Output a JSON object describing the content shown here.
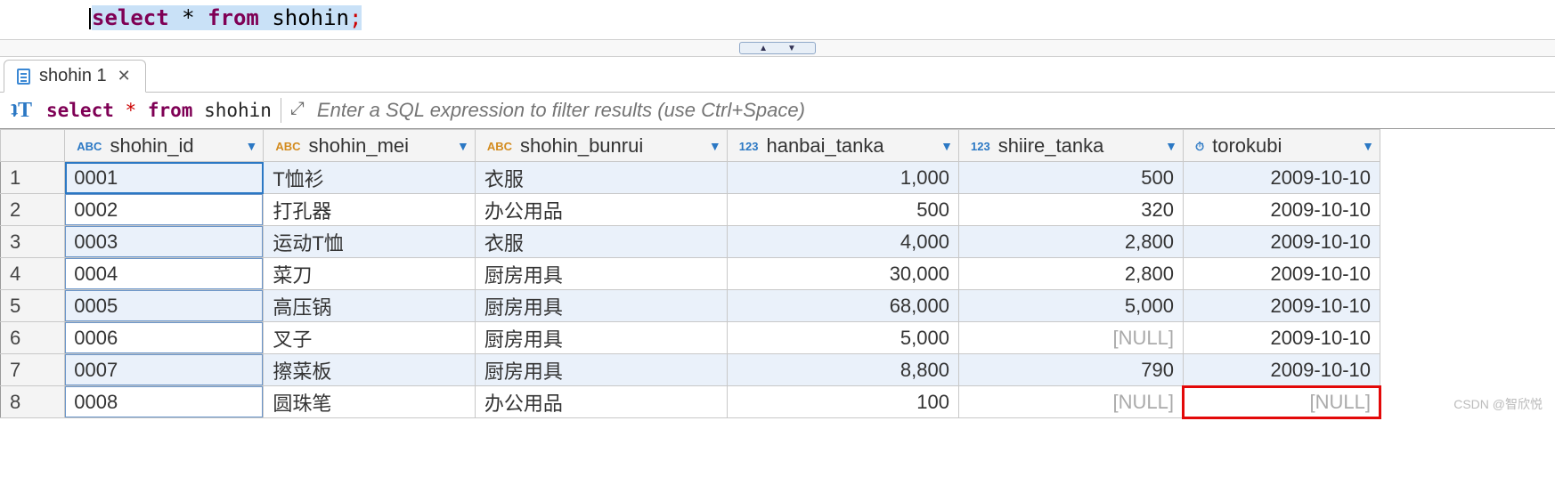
{
  "editor": {
    "sql_select": "select",
    "sql_star": "*",
    "sql_from": "from",
    "sql_table": "shohin",
    "sql_semi": ";"
  },
  "tab": {
    "label": "shohin 1"
  },
  "filter": {
    "kw_select": "select",
    "star": "*",
    "kw_from": "from",
    "tbl": "shohin",
    "placeholder": "Enter a SQL expression to filter results (use Ctrl+Space)"
  },
  "columns": [
    {
      "key": "shohin_id",
      "label": "shohin_id",
      "type": "ABC",
      "icon": "t-abc-key"
    },
    {
      "key": "shohin_mei",
      "label": "shohin_mei",
      "type": "ABC",
      "icon": "t-abc"
    },
    {
      "key": "shohin_bunrui",
      "label": "shohin_bunrui",
      "type": "ABC",
      "icon": "t-abc"
    },
    {
      "key": "hanbai_tanka",
      "label": "hanbai_tanka",
      "type": "123",
      "icon": "t-123"
    },
    {
      "key": "shiire_tanka",
      "label": "shiire_tanka",
      "type": "123",
      "icon": "t-123"
    },
    {
      "key": "torokubi",
      "label": "torokubi",
      "type": "⏱",
      "icon": "t-clock"
    }
  ],
  "rows": [
    {
      "n": "1",
      "shohin_id": "0001",
      "shohin_mei": "T恤衫",
      "shohin_bunrui": "衣服",
      "hanbai_tanka": "1,000",
      "shiire_tanka": "500",
      "torokubi": "2009-10-10"
    },
    {
      "n": "2",
      "shohin_id": "0002",
      "shohin_mei": "打孔器",
      "shohin_bunrui": "办公用品",
      "hanbai_tanka": "500",
      "shiire_tanka": "320",
      "torokubi": "2009-10-10"
    },
    {
      "n": "3",
      "shohin_id": "0003",
      "shohin_mei": "运动T恤",
      "shohin_bunrui": "衣服",
      "hanbai_tanka": "4,000",
      "shiire_tanka": "2,800",
      "torokubi": "2009-10-10"
    },
    {
      "n": "4",
      "shohin_id": "0004",
      "shohin_mei": "菜刀",
      "shohin_bunrui": "厨房用具",
      "hanbai_tanka": "30,000",
      "shiire_tanka": "2,800",
      "torokubi": "2009-10-10"
    },
    {
      "n": "5",
      "shohin_id": "0005",
      "shohin_mei": "高压锅",
      "shohin_bunrui": "厨房用具",
      "hanbai_tanka": "68,000",
      "shiire_tanka": "5,000",
      "torokubi": "2009-10-10"
    },
    {
      "n": "6",
      "shohin_id": "0006",
      "shohin_mei": "叉子",
      "shohin_bunrui": "厨房用具",
      "hanbai_tanka": "5,000",
      "shiire_tanka": "[NULL]",
      "torokubi": "2009-10-10",
      "shiire_null": true
    },
    {
      "n": "7",
      "shohin_id": "0007",
      "shohin_mei": "擦菜板",
      "shohin_bunrui": "厨房用具",
      "hanbai_tanka": "8,800",
      "shiire_tanka": "790",
      "torokubi": "2009-10-10"
    },
    {
      "n": "8",
      "shohin_id": "0008",
      "shohin_mei": "圆珠笔",
      "shohin_bunrui": "办公用品",
      "hanbai_tanka": "100",
      "shiire_tanka": "[NULL]",
      "torokubi": "[NULL]",
      "shiire_null": true,
      "torokubi_null": true,
      "torokubi_highlight": true
    }
  ],
  "watermark": "CSDN @智欣悦"
}
